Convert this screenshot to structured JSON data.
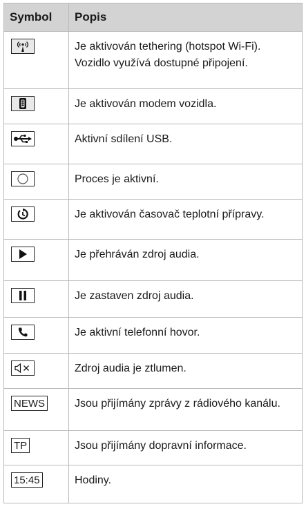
{
  "table": {
    "headers": [
      "Symbol",
      "Popis"
    ],
    "rows": [
      {
        "icon": "tethering-hotspot-icon",
        "description": "Je aktivován tethering (hotspot Wi-Fi). Vozidlo využívá dostupné připojení."
      },
      {
        "icon": "vehicle-modem-icon",
        "description": "Je aktivován modem vozidla."
      },
      {
        "icon": "usb-icon",
        "description": "Aktivní sdílení USB."
      },
      {
        "icon": "process-active-icon",
        "description": "Proces je aktivní."
      },
      {
        "icon": "climate-timer-icon",
        "description": "Je aktivován časovač teplotní přípravy."
      },
      {
        "icon": "play-icon",
        "description": "Je přehráván zdroj audia."
      },
      {
        "icon": "pause-icon",
        "description": "Je zastaven zdroj audia."
      },
      {
        "icon": "phone-call-icon",
        "description": "Je aktivní telefonní hovor."
      },
      {
        "icon": "mute-icon",
        "description": "Zdroj audia je ztlumen."
      },
      {
        "icon": "news-icon",
        "symbol_text": "NEWS",
        "description": "Jsou přijímány zprávy z rádiového kanálu."
      },
      {
        "icon": "tp-icon",
        "symbol_text": "TP",
        "description": "Jsou přijímány dopravní informace."
      },
      {
        "icon": "clock-icon",
        "symbol_text": "15:45",
        "description": "Hodiny."
      }
    ]
  }
}
